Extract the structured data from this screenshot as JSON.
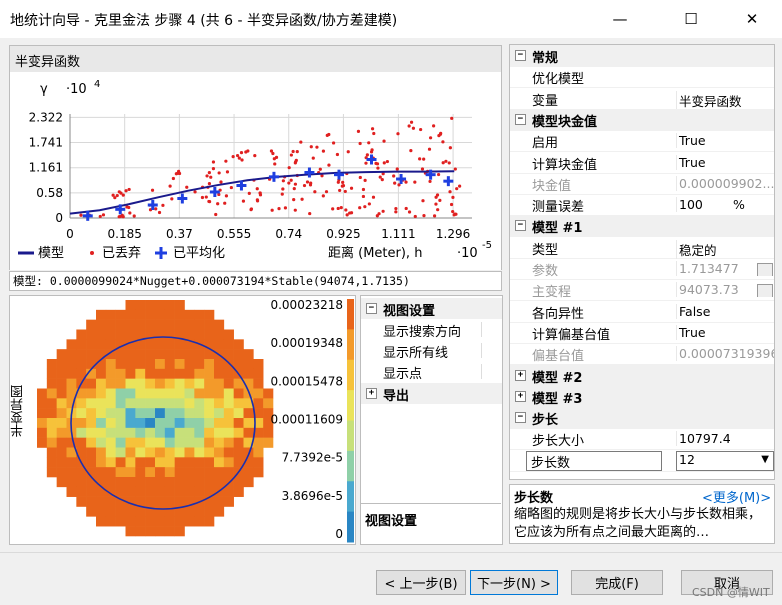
{
  "window": {
    "title": "地统计向导 - 克里金法 步骤 4 (共 6 - 半变异函数/协方差建模)",
    "minimize": "—",
    "maximize": "☐",
    "close": "✕"
  },
  "chart_panel": {
    "header": "半变异函数",
    "formula": "模型: 0.0000099024*Nugget+0.000073194*Stable(94074,1.7135)"
  },
  "chart_data": {
    "type": "scatter",
    "y_symbol": "γ",
    "y_multiplier": "·10",
    "y_exponent": "4",
    "yticks": [
      "2.322",
      "1.741",
      "1.161",
      "0.58",
      "0"
    ],
    "ytick_values": [
      2.322,
      1.741,
      1.161,
      0.58,
      0
    ],
    "xticks": [
      "0",
      "0.185",
      "0.37",
      "0.555",
      "0.74",
      "0.925",
      "1.111",
      "1.296"
    ],
    "xtick_values": [
      0,
      0.185,
      0.37,
      0.555,
      0.74,
      0.925,
      1.111,
      1.296
    ],
    "xlabel": "距离 (Meter), h",
    "x_multiplier": "·10",
    "x_exponent": "-5",
    "xlim": [
      0,
      1.36
    ],
    "ylim": [
      0,
      2.4
    ],
    "legend": [
      {
        "name": "模型",
        "color": "#1a1a8c",
        "symbol": "line"
      },
      {
        "name": "已丢弃",
        "color": "#e02020",
        "symbol": "dot"
      },
      {
        "name": "已平均化",
        "color": "#1f3fe0",
        "symbol": "cross"
      }
    ],
    "averaged": {
      "x": [
        0.06,
        0.17,
        0.28,
        0.38,
        0.49,
        0.58,
        0.69,
        0.81,
        0.91,
        1.02,
        1.12,
        1.22,
        1.28
      ],
      "y": [
        0.05,
        0.2,
        0.3,
        0.45,
        0.6,
        0.75,
        0.95,
        1.05,
        1.0,
        1.35,
        0.9,
        1.0,
        0.85
      ]
    },
    "model_curve": {
      "x": [
        0,
        0.1,
        0.2,
        0.3,
        0.4,
        0.5,
        0.6,
        0.7,
        0.8,
        0.9,
        1.0,
        1.1,
        1.2,
        1.3
      ],
      "y": [
        0.1,
        0.18,
        0.32,
        0.48,
        0.63,
        0.76,
        0.87,
        0.95,
        1.0,
        1.04,
        1.06,
        1.07,
        1.07,
        1.08
      ]
    },
    "discarded_seed": 17,
    "discarded_count": 230
  },
  "map_panel": {
    "ylabel": "半变异图",
    "legend_values": [
      "0.00023218",
      "0.00019348",
      "0.00015478",
      "0.00011609",
      "7.7392e-5",
      "3.8696e-5",
      "0"
    ],
    "colors": [
      "#e8641a",
      "#f39a2a",
      "#f6c23a",
      "#eae35a",
      "#c7e07a",
      "#8fd0a8",
      "#4aa9cf",
      "#2a86c4"
    ]
  },
  "view_panel": {
    "group1": "视图设置",
    "items": [
      "显示搜索方向",
      "显示所有线",
      "显示点"
    ],
    "group2": "导出",
    "footer": "视图设置"
  },
  "props": {
    "rows": [
      {
        "type": "cat",
        "label": "常规",
        "exp": "⊟"
      },
      {
        "type": "row",
        "label": "优化模型",
        "value": "",
        "icon": true
      },
      {
        "type": "row",
        "label": "变量",
        "value": "半变异函数"
      },
      {
        "type": "cat",
        "label": "模型块金值",
        "exp": "⊟"
      },
      {
        "type": "row",
        "label": "启用",
        "value": "True"
      },
      {
        "type": "row",
        "label": "计算块金值",
        "value": "True"
      },
      {
        "type": "row",
        "label": "块金值",
        "value": "0.000009902...",
        "disabled": true
      },
      {
        "type": "row",
        "label": "测量误差",
        "value": "100",
        "unit": "%"
      },
      {
        "type": "cat",
        "label": "模型 #1",
        "exp": "⊟"
      },
      {
        "type": "row",
        "label": "类型",
        "value": "稳定的"
      },
      {
        "type": "row",
        "label": "参数",
        "value": "1.713477",
        "disabled": true,
        "btn": true
      },
      {
        "type": "row",
        "label": "主变程",
        "value": "94073.73",
        "disabled": true,
        "btn": true
      },
      {
        "type": "row",
        "label": "各向异性",
        "value": "False"
      },
      {
        "type": "row",
        "label": "计算偏基台值",
        "value": "True"
      },
      {
        "type": "row",
        "label": "偏基台值",
        "value": "0.00007319396",
        "disabled": true
      },
      {
        "type": "cat",
        "label": "模型 #2",
        "exp": "⊞"
      },
      {
        "type": "cat",
        "label": "模型 #3",
        "exp": "⊞"
      },
      {
        "type": "cat",
        "label": "步长",
        "exp": "⊟"
      },
      {
        "type": "row",
        "label": "步长大小",
        "value": "10797.4"
      },
      {
        "type": "row",
        "label": "步长数",
        "value": "12",
        "dropdown": true
      }
    ]
  },
  "description": {
    "title": "步长数",
    "more": "<更多(M)>",
    "text": "缩略图的规则是将步长大小与步长数相乘，它应该为所有点之间最大距离的…"
  },
  "buttons": {
    "back": "< 上一步(B)",
    "next": "下一步(N) >",
    "finish": "完成(F)",
    "cancel": "取消"
  },
  "watermark": "CSDN @情WIT"
}
